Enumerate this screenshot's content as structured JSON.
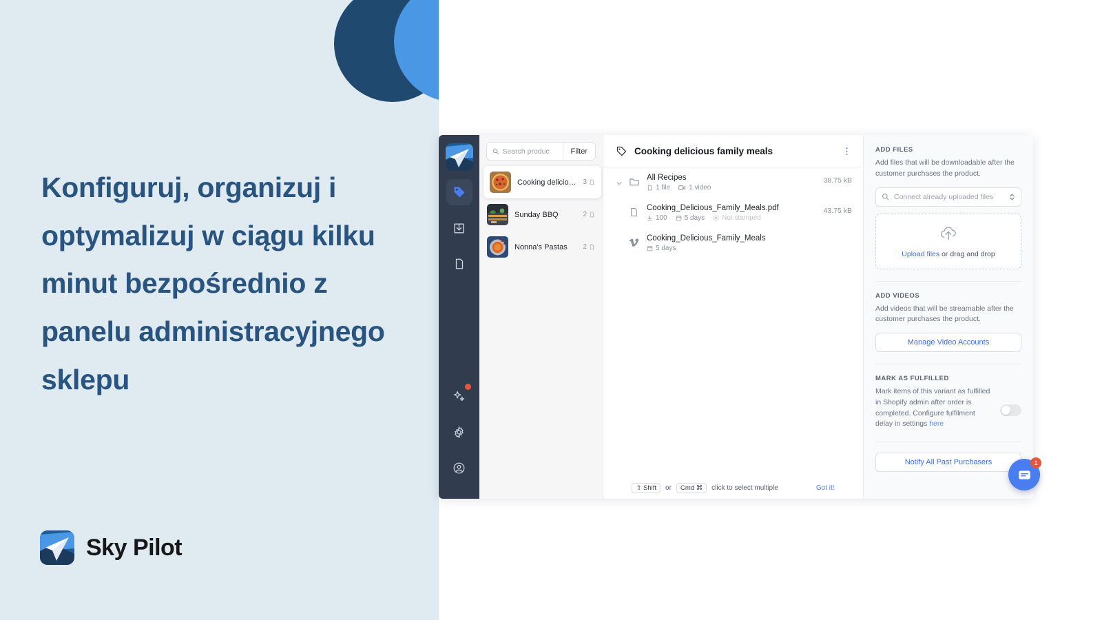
{
  "marketing": {
    "headline": "Konfiguruj, organizuj i optymalizuj w ciągu kilku minut bezpośrednio z panelu administracyjnego sklepu",
    "brand_name": "Sky Pilot",
    "bg_color": "#dfeaf1",
    "headline_color": "#28547f",
    "circle_navy": "#20496f",
    "circle_blue": "#4a98e5"
  },
  "app": {
    "sidebar": {
      "items": [
        {
          "icon": "sky-pilot-logo-icon",
          "label": "Sky Pilot"
        },
        {
          "icon": "tag-icon",
          "label": "Products",
          "active": true
        },
        {
          "icon": "inbox-download-icon",
          "label": "Downloads"
        },
        {
          "icon": "document-icon",
          "label": "Files"
        }
      ],
      "bottom_items": [
        {
          "icon": "sparkles-icon",
          "label": "What's new",
          "badge": true
        },
        {
          "icon": "gear-icon",
          "label": "Settings"
        },
        {
          "icon": "account-icon",
          "label": "Account"
        }
      ]
    },
    "product_list": {
      "search_placeholder": "Search produc",
      "search_value": "",
      "filter_label": "Filter",
      "items": [
        {
          "name": "Cooking delicious f...",
          "count": "3",
          "selected": true,
          "thumb": "pizza-thumbnail"
        },
        {
          "name": "Sunday BBQ",
          "count": "2",
          "selected": false,
          "thumb": "bbq-thumbnail"
        },
        {
          "name": "Nonna's Pastas",
          "count": "2",
          "selected": false,
          "thumb": "pasta-thumbnail"
        }
      ]
    },
    "files_panel": {
      "variant_title": "Cooking delicious family meals",
      "rows": [
        {
          "type": "folder",
          "name": "All Recipes",
          "size": "38.75 kB",
          "meta": [
            {
              "icon": "file-icon",
              "text": "1 file",
              "muted": false
            },
            {
              "icon": "video-icon",
              "text": "1 video",
              "muted": false
            }
          ]
        },
        {
          "type": "file",
          "name": "Cooking_Delicious_Family_Meals.pdf",
          "size": "43.75 kB",
          "meta": [
            {
              "icon": "download-icon",
              "text": "100",
              "muted": false
            },
            {
              "icon": "calendar-icon",
              "text": "5 days",
              "muted": false
            },
            {
              "icon": "stamp-icon",
              "text": "Not stamped",
              "muted": true
            }
          ]
        },
        {
          "type": "video",
          "name": "Cooking_Delicious_Family_Meals",
          "size": "",
          "meta": [
            {
              "icon": "calendar-icon",
              "text": "5 days",
              "muted": false
            }
          ]
        }
      ],
      "hint": {
        "key1": "⇧ Shift",
        "joiner": "or",
        "key2": "Cmd ⌘",
        "text": "click to select multiple",
        "dismiss": "Got it!"
      }
    },
    "settings_panel": {
      "add_files": {
        "title": "ADD FILES",
        "description": "Add files that will be downloadable after the customer purchases the product.",
        "connect_placeholder": "Connect already uploaded files",
        "upload_link": "Upload files",
        "upload_rest": " or drag and drop"
      },
      "add_videos": {
        "title": "ADD VIDEOS",
        "description": "Add videos that will be streamable after the customer purchases the product.",
        "manage_button": "Manage Video Accounts"
      },
      "mark_fulfilled": {
        "title": "MARK AS FULFILLED",
        "description": "Mark items of this variant as fulfilled in Shopify admin after order is completed. Configure fulfilment delay in settings here",
        "link_text": "here",
        "toggle_on": false
      },
      "notify_button": "Notify All Past Purchasers"
    },
    "chat_widget": {
      "unread": "1",
      "icon": "chat-icon",
      "color": "#4a7ef0"
    }
  }
}
